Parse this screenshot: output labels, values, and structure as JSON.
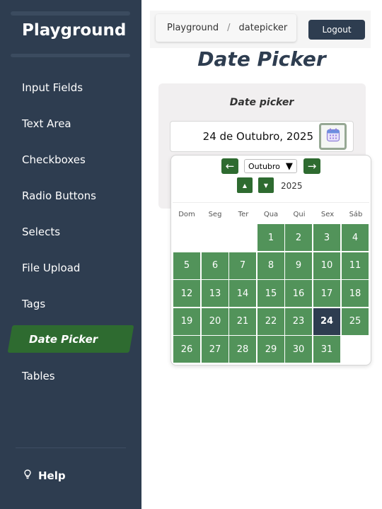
{
  "sidebar": {
    "brand": "Playground",
    "items": [
      {
        "label": "Input Fields"
      },
      {
        "label": "Text Area"
      },
      {
        "label": "Checkboxes"
      },
      {
        "label": "Radio Buttons"
      },
      {
        "label": "Selects"
      },
      {
        "label": "File Upload"
      },
      {
        "label": "Tags"
      },
      {
        "label": "Date Picker",
        "active": true
      },
      {
        "label": "Tables"
      }
    ],
    "help": "Help",
    "colors": {
      "background": "#2e3d50",
      "active": "#2e6b30"
    }
  },
  "topbar": {
    "breadcrumb": [
      "Playground",
      "datepicker"
    ],
    "breadcrumb_separator": "/",
    "logout_label": "Logout"
  },
  "page": {
    "title": "Date Picker",
    "card_title": "Date picker",
    "input_value": "24 de Outubro, 2025",
    "calendar_icon": "calendar-icon"
  },
  "datepicker": {
    "prev_label": "←",
    "next_label": "→",
    "month": "Outubro",
    "month_dropdown_arrow": "▼",
    "year_up": "▲",
    "year_down": "▼",
    "year": "2025",
    "weekdays": [
      "Dom",
      "Seg",
      "Ter",
      "Qua",
      "Qui",
      "Sex",
      "Sáb"
    ],
    "first_weekday_index": 3,
    "days_in_month": 31,
    "selected_day": 24,
    "colors": {
      "day": "#52935a",
      "selected": "#2e3d50",
      "nav": "#2e6b30"
    }
  }
}
